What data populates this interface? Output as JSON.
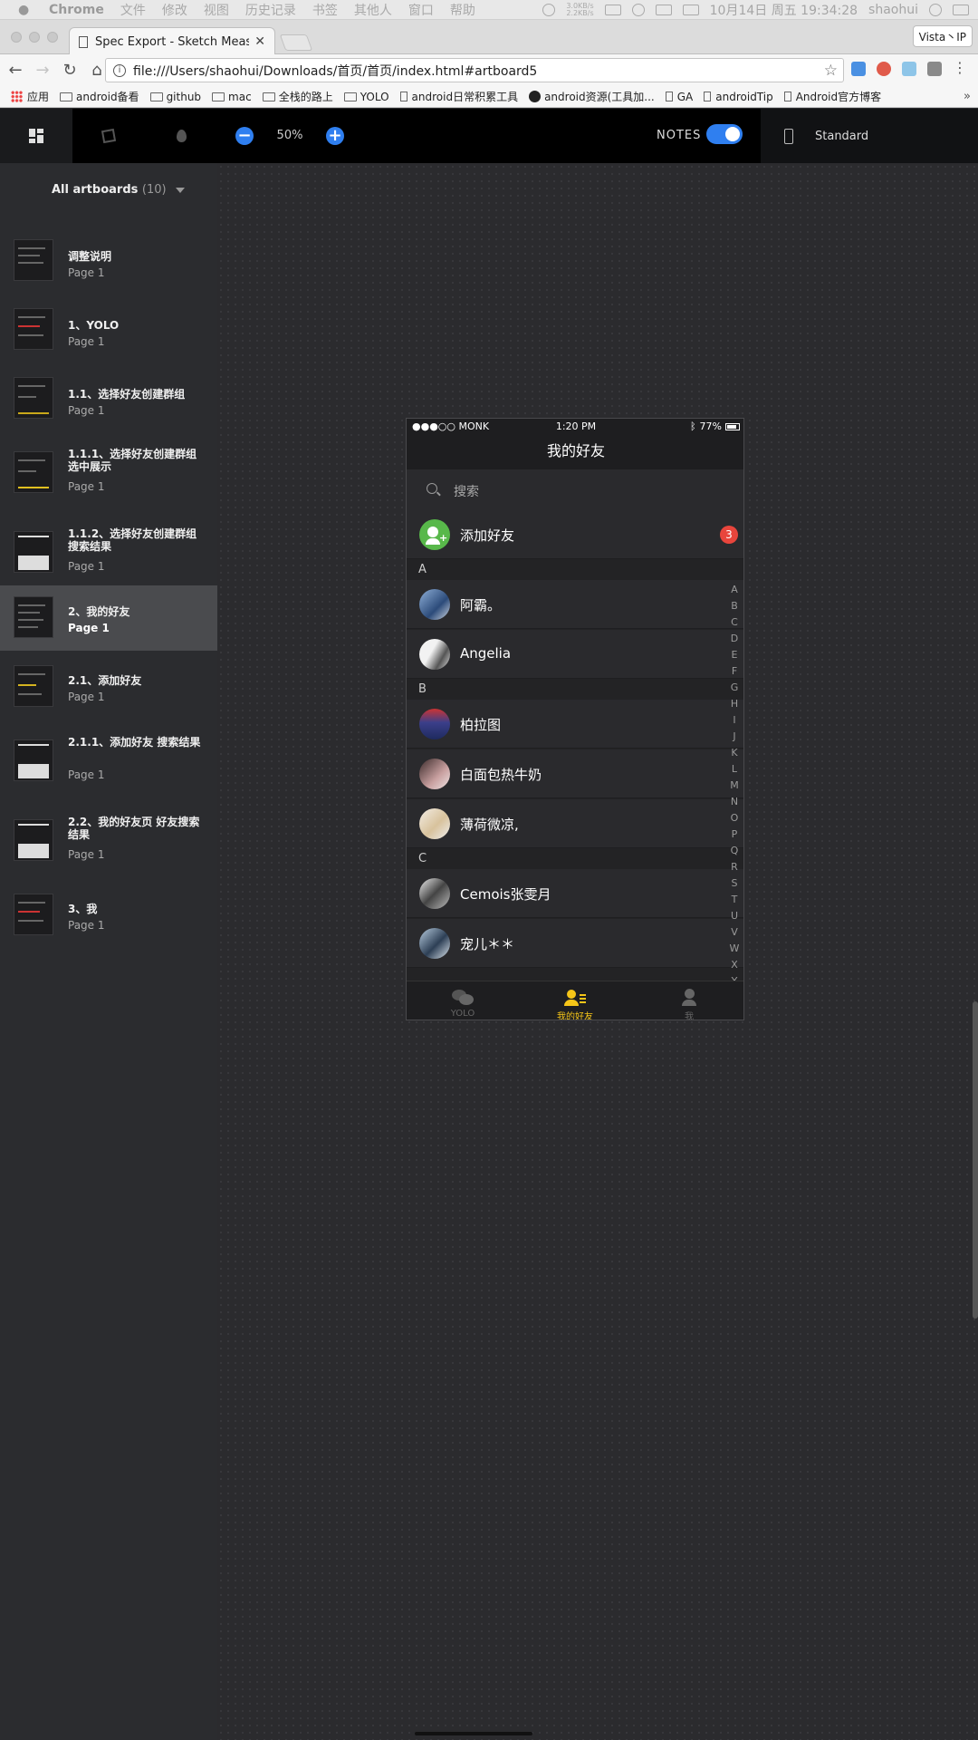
{
  "menubar": {
    "app": "Chrome",
    "items": [
      "文件",
      "修改",
      "视图",
      "历史记录",
      "书签",
      "其他人",
      "窗口",
      "帮助"
    ],
    "net_up": "3.0KB/s",
    "net_down": "2.2KB/s",
    "datetime": "10月14日 周五 19:34:28",
    "user": "shaohui"
  },
  "browser": {
    "tab_title": "Spec Export - Sketch Measure",
    "profile": "Vista丶IP",
    "url": "file:///Users/shaohui/Downloads/首页/首页/index.html#artboard5",
    "bookmarks": [
      {
        "label": "应用",
        "type": "apps"
      },
      {
        "label": "android备看",
        "type": "folder"
      },
      {
        "label": "github",
        "type": "folder"
      },
      {
        "label": "mac",
        "type": "folder"
      },
      {
        "label": "全栈的路上",
        "type": "folder"
      },
      {
        "label": "YOLO",
        "type": "folder"
      },
      {
        "label": "android日常积累工具",
        "type": "page"
      },
      {
        "label": "android资源(工具加...",
        "type": "github"
      },
      {
        "label": "GA",
        "type": "page"
      },
      {
        "label": "androidTip",
        "type": "page"
      },
      {
        "label": "Android官方博客",
        "type": "page"
      }
    ]
  },
  "measure": {
    "zoom": "50%",
    "notes_label": "NOTES",
    "notes_on": true,
    "device": "Standard"
  },
  "sidebar": {
    "header": "All artboards",
    "count": "(10)",
    "artboards": [
      {
        "name": "调整说明",
        "page": "Page 1"
      },
      {
        "name": "1、YOLO",
        "page": "Page 1"
      },
      {
        "name": "1.1、选择好友创建群组",
        "page": "Page 1"
      },
      {
        "name": "1.1.1、选择好友创建群组 选中展示",
        "page": "Page 1"
      },
      {
        "name": "1.1.2、选择好友创建群组 搜索结果",
        "page": "Page 1"
      },
      {
        "name": "2、我的好友",
        "page": "Page 1",
        "selected": true
      },
      {
        "name": "2.1、添加好友",
        "page": "Page 1"
      },
      {
        "name": "2.1.1、添加好友 搜索结果",
        "page": "Page 1"
      },
      {
        "name": "2.2、我的好友页 好友搜索结果",
        "page": "Page 1"
      },
      {
        "name": "3、我",
        "page": "Page 1"
      }
    ]
  },
  "phone": {
    "status": {
      "carrier": "●●●○○ MONK",
      "time": "1:20 PM",
      "battery": "77%"
    },
    "title": "我的好友",
    "search_placeholder": "搜索",
    "add_friend": {
      "label": "添加好友",
      "badge": "3"
    },
    "sections": [
      {
        "letter": "A",
        "friends": [
          "阿霸。",
          "Angelia"
        ]
      },
      {
        "letter": "B",
        "friends": [
          "柏拉图",
          "白面包热牛奶",
          "薄荷微凉,"
        ]
      },
      {
        "letter": "C",
        "friends": [
          "Cemois张雯月",
          "宠儿＊＊"
        ]
      }
    ],
    "index_letters": [
      "A",
      "B",
      "C",
      "D",
      "E",
      "F",
      "G",
      "H",
      "I",
      "J",
      "K",
      "L",
      "M",
      "N",
      "O",
      "P",
      "Q",
      "R",
      "S",
      "T",
      "U",
      "V",
      "W",
      "X",
      "Y"
    ],
    "tabs": [
      {
        "label": "YOLO",
        "icon": "chat-bubbles-icon"
      },
      {
        "label": "我的好友",
        "icon": "friends-icon",
        "active": true
      },
      {
        "label": "我",
        "icon": "person-icon"
      }
    ],
    "colors": {
      "accent": "#f5c518",
      "add_green": "#58b84a",
      "badge_red": "#e8453c",
      "measure_blue": "#2f7ff0"
    }
  }
}
